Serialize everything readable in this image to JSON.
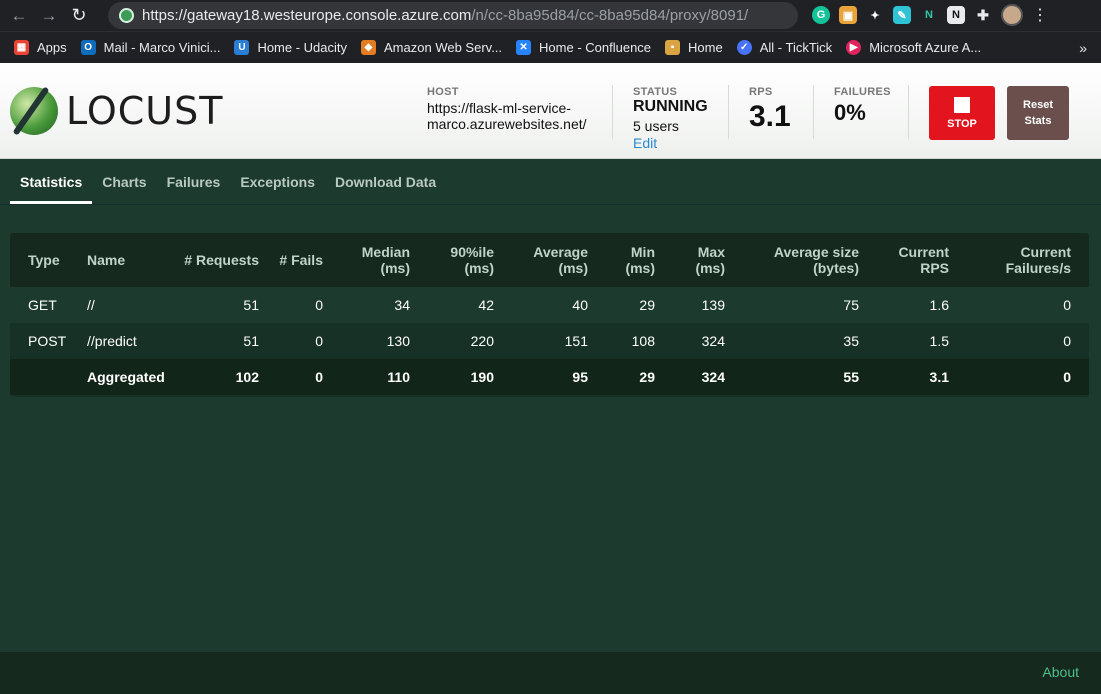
{
  "browser": {
    "url_host": "https://gateway18.westeurope.console.azure.com",
    "url_path": "/n/cc-8ba95d84/cc-8ba95d84/proxy/8091/",
    "bookmarks": [
      {
        "label": "Apps",
        "icon": "apps-grid-icon",
        "color": "#ea4335"
      },
      {
        "label": "Mail - Marco Vinici...",
        "icon": "outlook-icon",
        "color": "#0f6cbd"
      },
      {
        "label": "Home - Udacity",
        "icon": "udacity-icon",
        "color": "#2a7fd4"
      },
      {
        "label": "Amazon Web Serv...",
        "icon": "aws-icon",
        "color": "#e57c22"
      },
      {
        "label": "Home - Confluence",
        "icon": "confluence-icon",
        "color": "#2684ff"
      },
      {
        "label": "Home",
        "icon": "box-icon",
        "color": "#d9a441"
      },
      {
        "label": "All - TickTick",
        "icon": "ticktick-icon",
        "color": "#4772fa"
      },
      {
        "label": "Microsoft Azure A...",
        "icon": "azure-icon",
        "color": "#e0245e"
      }
    ]
  },
  "header": {
    "logo_text": "LOCUST",
    "host_label": "HOST",
    "host_value": "https://flask-ml-service-marco.azurewebsites.net/",
    "status_label": "STATUS",
    "status_value": "RUNNING",
    "users": "5 users",
    "edit": "Edit",
    "rps_label": "RPS",
    "rps_value": "3.1",
    "failures_label": "FAILURES",
    "failures_value": "0%",
    "stop_label": "STOP",
    "reset_label": "Reset Stats"
  },
  "tabs": [
    "Statistics",
    "Charts",
    "Failures",
    "Exceptions",
    "Download Data"
  ],
  "table": {
    "headers": [
      "Type",
      "Name",
      "# Requests",
      "# Fails",
      "Median (ms)",
      "90%ile (ms)",
      "Average (ms)",
      "Min (ms)",
      "Max (ms)",
      "Average size (bytes)",
      "Current RPS",
      "Current Failures/s"
    ],
    "rows": [
      [
        "GET",
        "//",
        "51",
        "0",
        "34",
        "42",
        "40",
        "29",
        "139",
        "75",
        "1.6",
        "0"
      ],
      [
        "POST",
        "//predict",
        "51",
        "0",
        "130",
        "220",
        "151",
        "108",
        "324",
        "35",
        "1.5",
        "0"
      ],
      [
        "",
        "Aggregated",
        "102",
        "0",
        "110",
        "190",
        "95",
        "29",
        "324",
        "55",
        "3.1",
        "0"
      ]
    ]
  },
  "footer": {
    "about": "About"
  },
  "colors": {
    "stop": "#e2151e",
    "reset": "#6a4f4c",
    "link": "#2a8ad0",
    "about": "#4fbf8a"
  }
}
